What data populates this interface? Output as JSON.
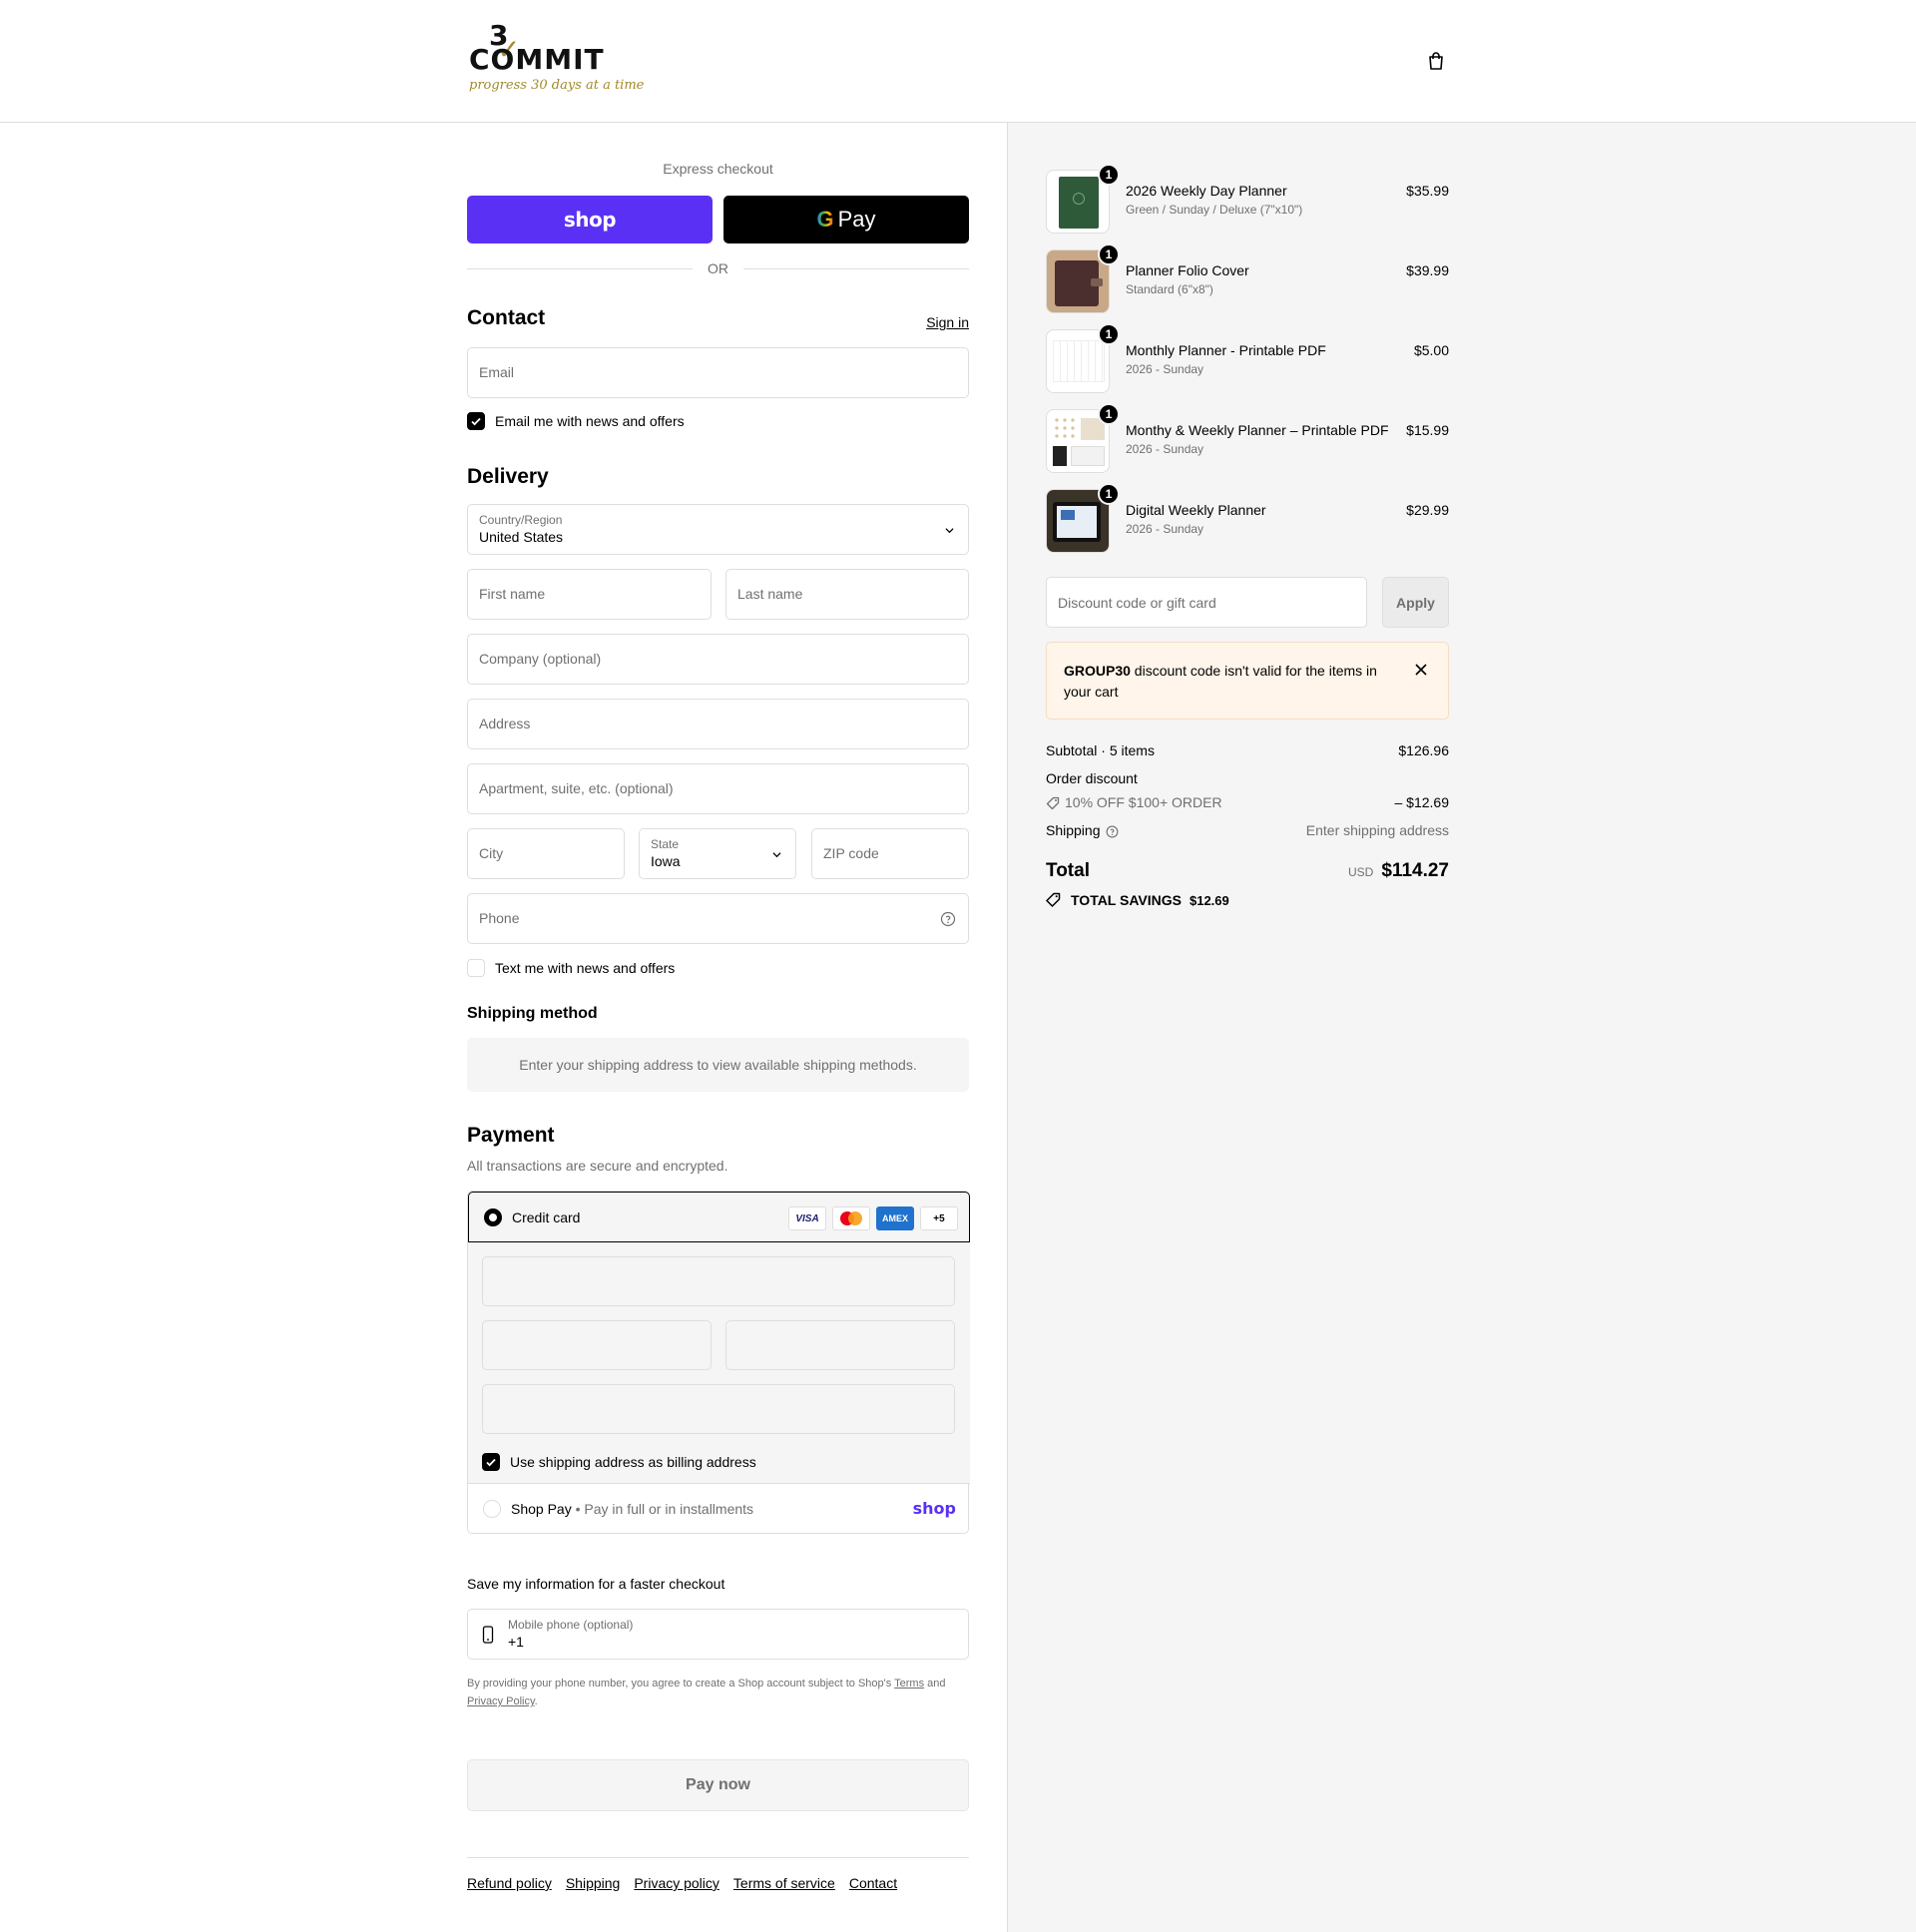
{
  "header": {
    "logo": {
      "number": "3",
      "word": "COMMIT",
      "tagline": "progress 30 days at a time"
    },
    "cart_icon": "shopping-bag-icon"
  },
  "express": {
    "label": "Express checkout",
    "shop_pay": "shop",
    "gpay_g": "G",
    "gpay_text": "Pay",
    "or": "OR"
  },
  "contact": {
    "title": "Contact",
    "sign_in": "Sign in",
    "email_placeholder": "Email",
    "news_checkbox": "Email me with news and offers",
    "news_checked": true
  },
  "delivery": {
    "title": "Delivery",
    "country_label": "Country/Region",
    "country_value": "United States",
    "first_name": "First name",
    "last_name": "Last name",
    "company": "Company (optional)",
    "address": "Address",
    "apartment": "Apartment, suite, etc. (optional)",
    "city": "City",
    "state_label": "State",
    "state_value": "Iowa",
    "zip": "ZIP code",
    "phone": "Phone",
    "text_checkbox": "Text me with news and offers",
    "text_checked": false
  },
  "shipping_method": {
    "title": "Shipping method",
    "message": "Enter your shipping address to view available shipping methods."
  },
  "payment": {
    "title": "Payment",
    "subtitle": "All transactions are secure and encrypted.",
    "credit_card": "Credit card",
    "card_logos": [
      "VISA",
      "mastercard",
      "AMEX"
    ],
    "more_cards": "+5",
    "billing_checkbox": "Use shipping address as billing address",
    "billing_checked": true,
    "shop_pay_label": "Shop Pay",
    "shop_pay_sub": "Pay in full or in installments",
    "shop_pay_logo": "shop"
  },
  "save_info": {
    "title": "Save my information for a faster checkout",
    "mobile_label": "Mobile phone (optional)",
    "mobile_value": "+1",
    "legal_prefix": "By providing your phone number, you agree to create a Shop account subject to Shop's",
    "terms": "Terms",
    "and": "and",
    "privacy": "Privacy Policy",
    "period": "."
  },
  "pay_now": "Pay now",
  "footer": {
    "links": [
      "Refund policy",
      "Shipping",
      "Privacy policy",
      "Terms of service",
      "Contact"
    ]
  },
  "summary": {
    "items": [
      {
        "name": "2026 Weekly Day Planner",
        "variant": "Green / Sunday / Deluxe (7\"x10\")",
        "price": "$35.99",
        "qty": "1"
      },
      {
        "name": "Planner Folio Cover",
        "variant": "Standard (6\"x8\")",
        "price": "$39.99",
        "qty": "1"
      },
      {
        "name": "Monthly Planner - Printable PDF",
        "variant": "2026 - Sunday",
        "price": "$5.00",
        "qty": "1"
      },
      {
        "name": "Monthy & Weekly Planner – Printable PDF",
        "variant": "2026 - Sunday",
        "price": "$15.99",
        "qty": "1"
      },
      {
        "name": "Digital Weekly Planner",
        "variant": "2026 - Sunday",
        "price": "$29.99",
        "qty": "1"
      }
    ],
    "discount_placeholder": "Discount code or gift card",
    "apply": "Apply",
    "warning_code": "GROUP30",
    "warning_text": " discount code isn't valid for the items in your cart",
    "subtotal_label": "Subtotal · 5 items",
    "subtotal_value": "$126.96",
    "order_discount_label": "Order discount",
    "discount_name": "10% OFF $100+ ORDER",
    "discount_value": "– $12.69",
    "shipping_label": "Shipping",
    "shipping_value": "Enter shipping address",
    "total_label": "Total",
    "currency": "USD",
    "total_value": "$114.27",
    "savings_label": "TOTAL SAVINGS",
    "savings_value": "$12.69"
  },
  "colors": {
    "shop_purple": "#5a31f4",
    "border": "#dedede",
    "muted": "#707070",
    "summary_bg": "#f5f5f5",
    "warning_bg": "#fff5ea"
  }
}
